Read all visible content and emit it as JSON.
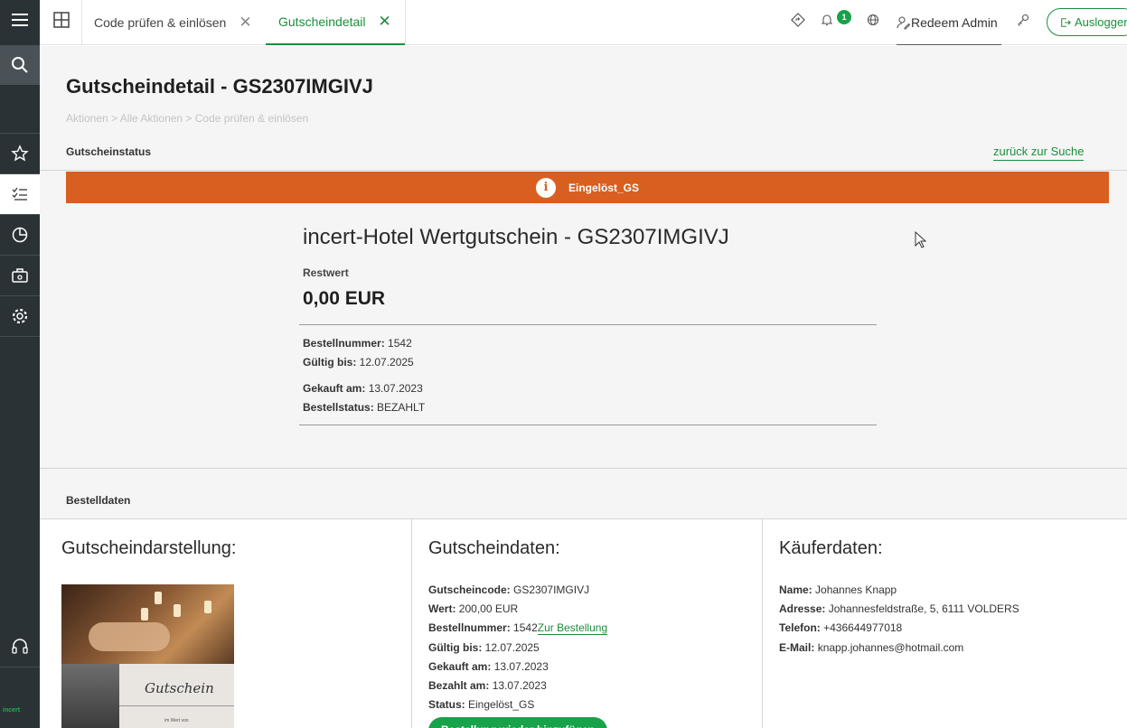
{
  "topbar": {
    "tabs": [
      {
        "label": "Code prüfen & einlösen",
        "active": false
      },
      {
        "label": "Gutscheindetail",
        "active": true
      }
    ],
    "notification_count": "1",
    "user_name": "Redeem Admin",
    "logout_label": "Ausloggen"
  },
  "sidebar": {
    "items": [
      "menu-icon",
      "search-icon",
      "star-icon",
      "checklist-icon",
      "pie-chart-icon",
      "briefcase-icon",
      "gear-icon",
      "headset-icon"
    ],
    "brand": "incert"
  },
  "page": {
    "title": "Gutscheindetail - GS2307IMGIVJ",
    "breadcrumb": "Aktionen > Alle Aktionen > Code prüfen & einlösen",
    "status_section": "Gutscheinstatus",
    "back_link": "zurück zur Suche",
    "status_text": "Eingelöst_GS",
    "status_color": "#d95f20"
  },
  "voucher": {
    "name": "incert-Hotel Wertgutschein - GS2307IMGIVJ",
    "rest_label": "Restwert",
    "rest_value": "0,00 EUR",
    "order_no_label": "Bestellnummer:",
    "order_no": "1542",
    "valid_until_label": "Gültig bis:",
    "valid_until": "12.07.2025",
    "bought_label": "Gekauft am:",
    "bought": "13.07.2023",
    "order_status_label": "Bestellstatus:",
    "order_status": "BEZAHLT"
  },
  "order": {
    "section": "Bestelldaten",
    "display_title": "Gutscheindarstellung:",
    "image_text": "Gutschein",
    "image_subtext": "im Wert von",
    "data_title": "Gutscheindaten:",
    "data": [
      {
        "label": "Gutscheincode:",
        "value": "GS2307IMGIVJ"
      },
      {
        "label": "Wert:",
        "value": "200,00 EUR"
      },
      {
        "label": "Bestellnummer:",
        "value": "1542",
        "link": "Zur Bestellung"
      },
      {
        "label": "Gültig bis:",
        "value": "12.07.2025"
      },
      {
        "label": "Gekauft am:",
        "value": "13.07.2023"
      },
      {
        "label": "Bezahlt am:",
        "value": "13.07.2023"
      },
      {
        "label": "Status:",
        "value": "Eingelöst_GS"
      }
    ],
    "button_label": "Bestellung wieder hinzufügen",
    "buyer_title": "Käuferdaten:",
    "buyer": [
      {
        "label": "Name:",
        "value": "Johannes Knapp"
      },
      {
        "label": "Adresse:",
        "value": "Johannesfeldstraße, 5, 6111 VOLDERS"
      },
      {
        "label": "Telefon:",
        "value": "+436644977018"
      },
      {
        "label": "E-Mail:",
        "value": "knapp.johannes@hotmail.com"
      }
    ]
  },
  "colors": {
    "accent": "#1a8f3a",
    "rail": "#2b3236",
    "status": "#d95f20"
  }
}
